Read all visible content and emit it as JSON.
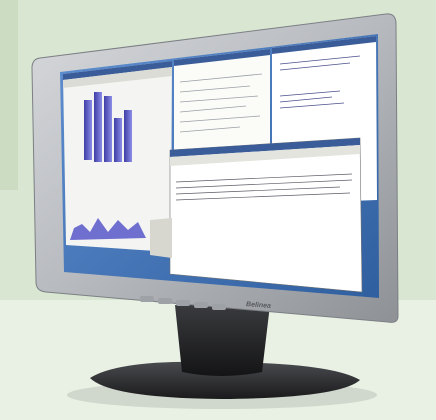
{
  "brand": {
    "logo_text": "Belinea"
  },
  "colors": {
    "background": "#d9e6d2",
    "bezel": "#b9bcc0",
    "screen_desktop": "#3d6fae",
    "chart_bar": "#6f6fd0"
  },
  "icons": {
    "monitor": "monitor-icon",
    "power_button": "power-button-icon"
  }
}
